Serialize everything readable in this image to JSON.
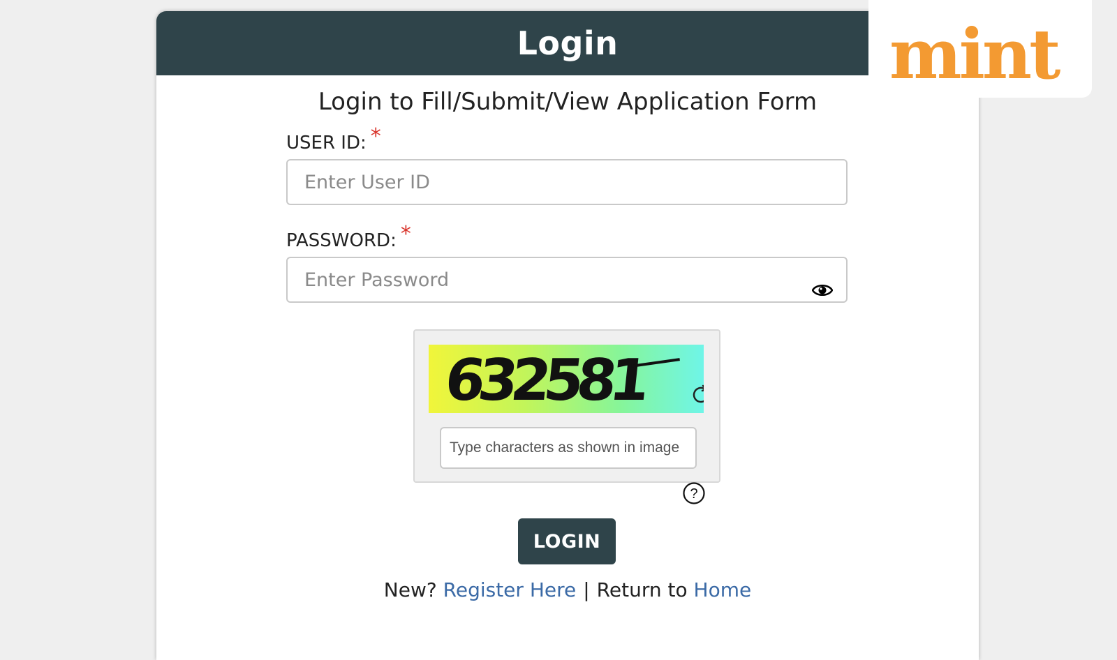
{
  "header": {
    "title": "Login"
  },
  "subtitle": "Login to Fill/Submit/View Application Form",
  "user_id": {
    "label": "USER ID:",
    "required_mark": "*",
    "placeholder": "Enter User ID",
    "value": ""
  },
  "password": {
    "label": "PASSWORD:",
    "required_mark": "*",
    "placeholder": "Enter Password",
    "value": "",
    "toggle_icon": "eye-icon"
  },
  "captcha": {
    "image_text": "632581",
    "refresh_icon": "refresh-icon",
    "input_placeholder": "Type characters as shown in image",
    "help_icon": "question-circle-icon",
    "gradient_colors": [
      "#f1f53a",
      "#c2f55a",
      "#86f59a",
      "#6ff5e8"
    ]
  },
  "login_button": {
    "label": "LOGIN"
  },
  "footer": {
    "new_prefix": "New?",
    "register_link": "Register Here",
    "separator": "|",
    "return_prefix": "Return to",
    "home_link": "Home"
  },
  "watermark": {
    "brand": "mint",
    "color": "#f39a32"
  },
  "colors": {
    "header_bg": "#2f444a",
    "link": "#3b6aa6",
    "required": "#d9342b"
  }
}
